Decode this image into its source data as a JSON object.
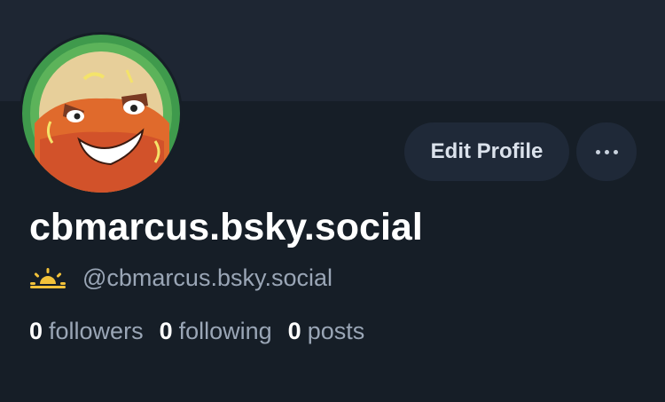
{
  "profile": {
    "display_name": "cbmarcus.bsky.social",
    "handle": "@cbmarcus.bsky.social",
    "status_emoji": "sun-behind-horizon-icon"
  },
  "actions": {
    "edit_label": "Edit Profile",
    "more_icon": "ellipsis-icon"
  },
  "stats": {
    "followers": {
      "count": "0",
      "label": "followers"
    },
    "following": {
      "count": "0",
      "label": "following"
    },
    "posts": {
      "count": "0",
      "label": "posts"
    }
  },
  "colors": {
    "background": "#161e27",
    "banner": "#1e2633",
    "button_bg": "#1f2938",
    "text_primary": "#ffffff",
    "text_secondary": "#9aa6b6",
    "sun": "#f2c23a"
  }
}
